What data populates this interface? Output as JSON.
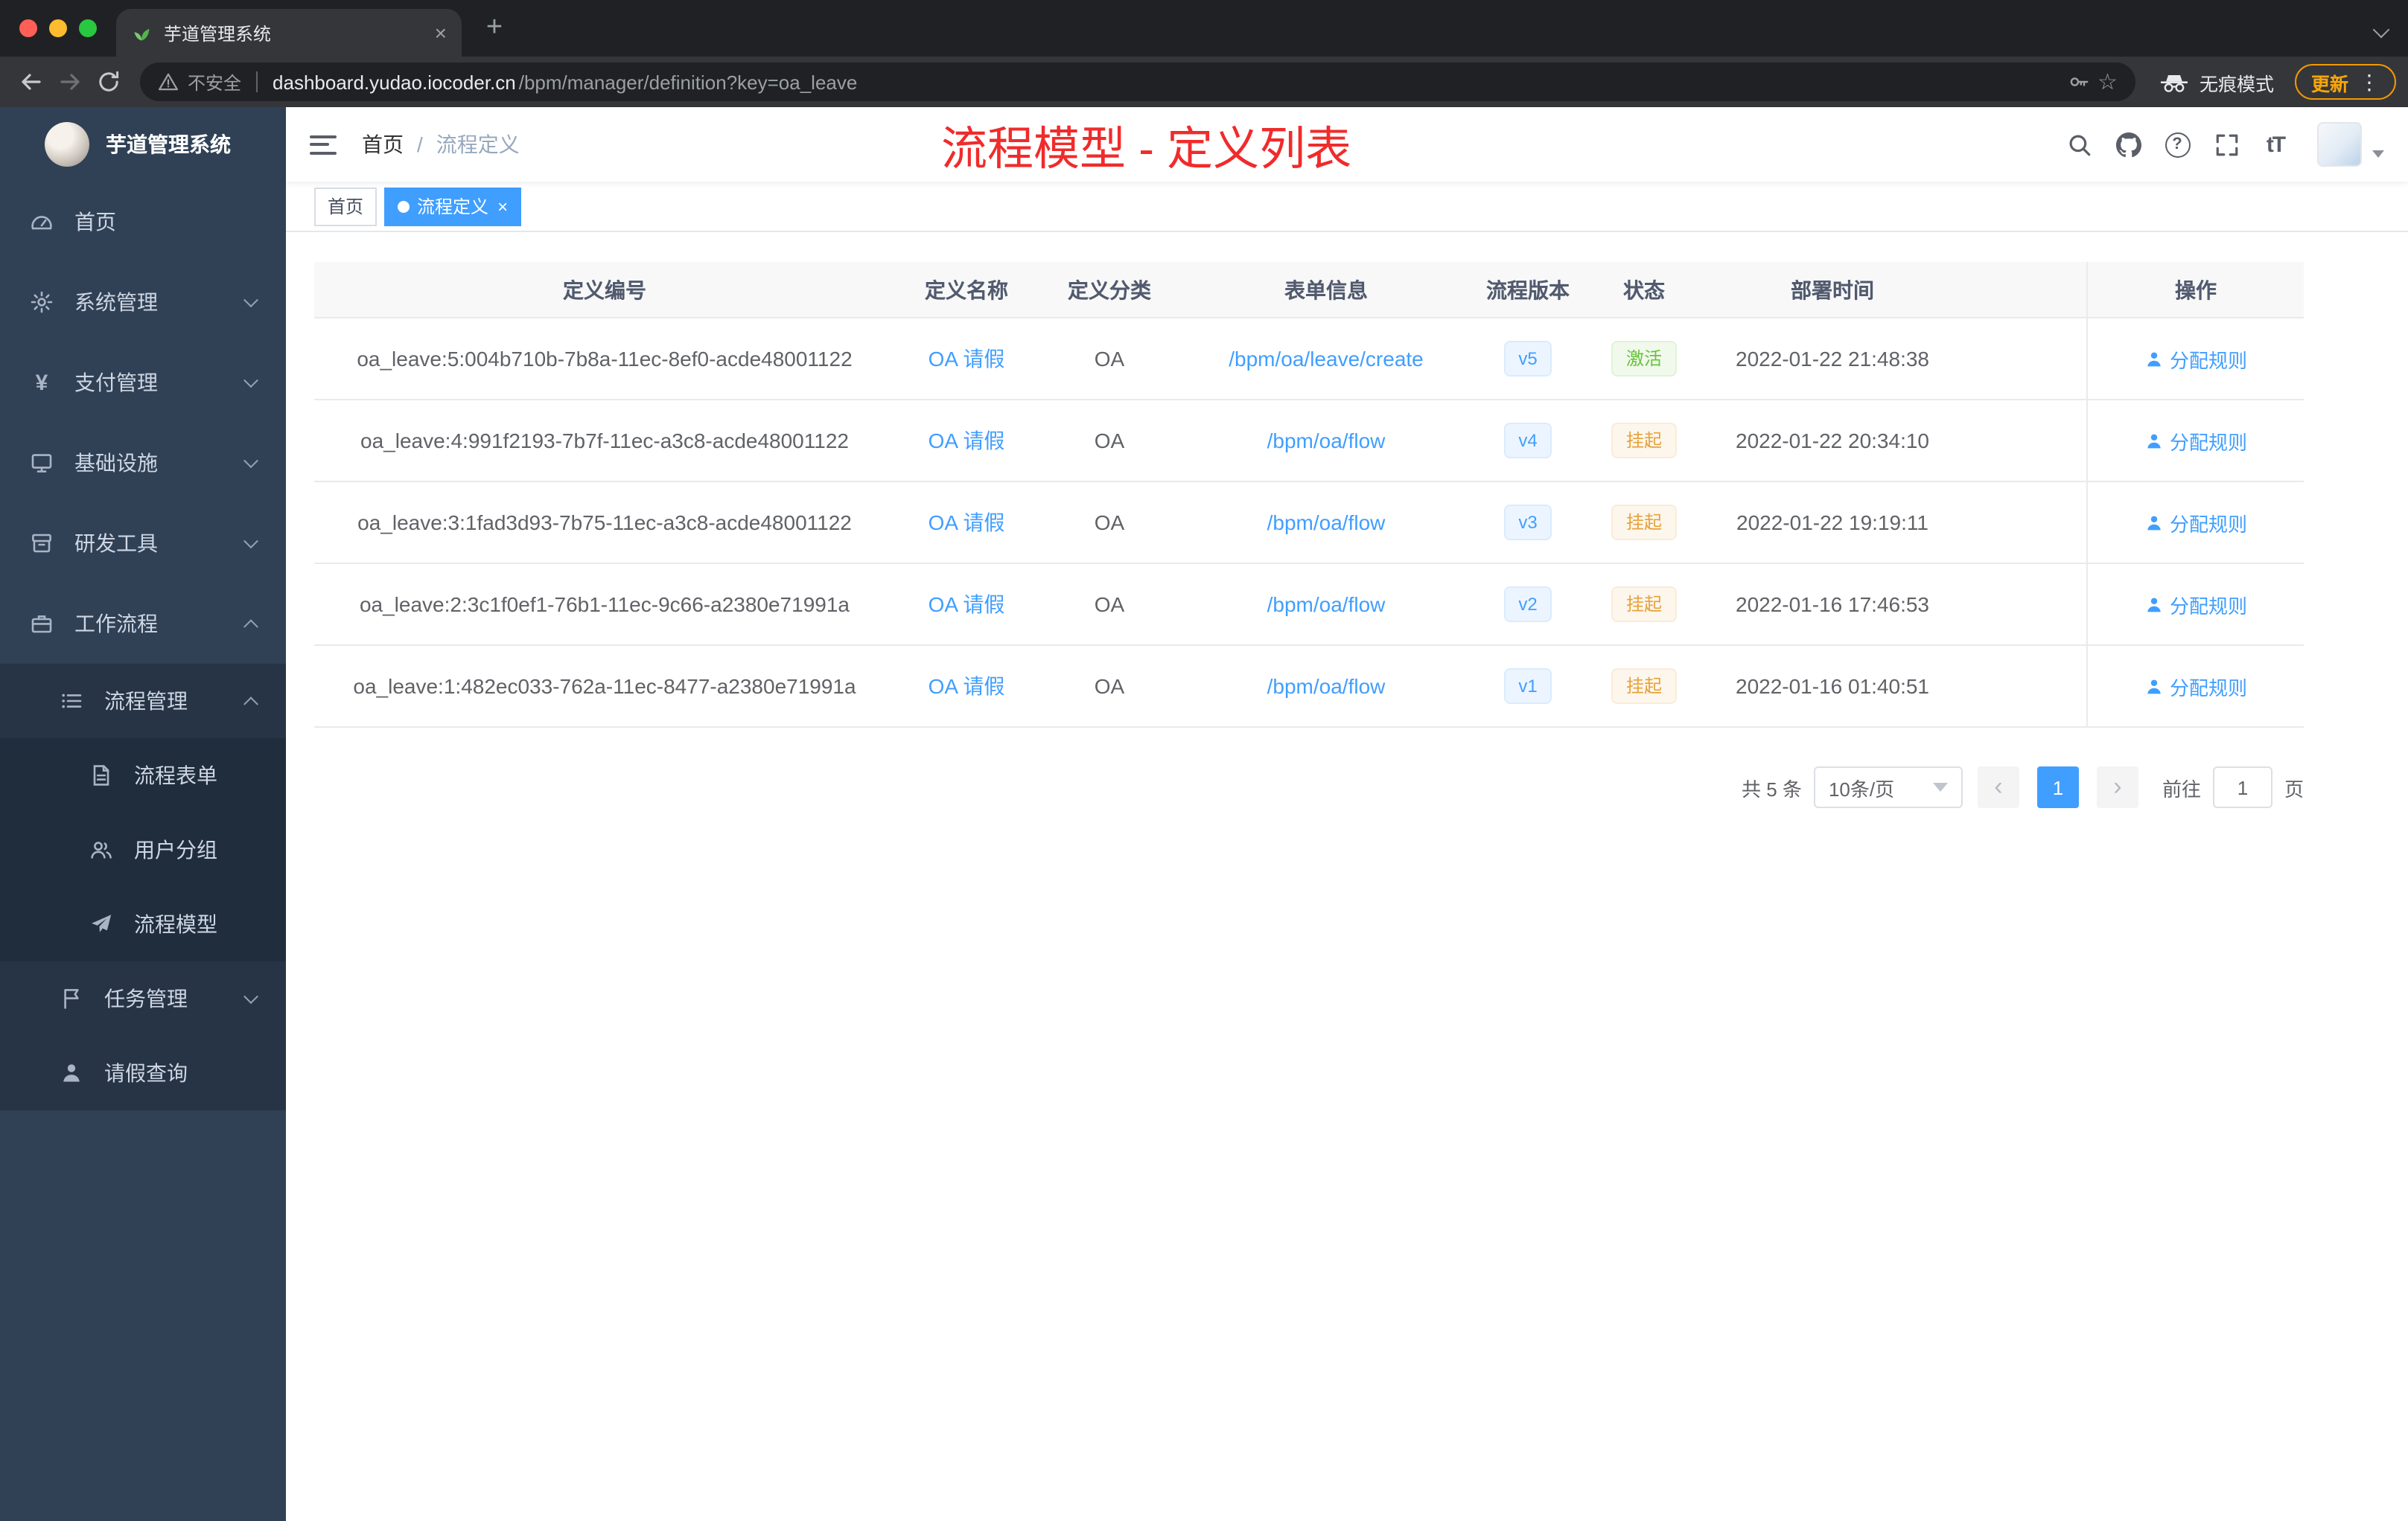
{
  "browser": {
    "tab_title": "芋道管理系统",
    "security_label": "不安全",
    "url_host": "dashboard.yudao.iocoder.cn",
    "url_path": "/bpm/manager/definition?key=oa_leave",
    "incognito_label": "无痕模式",
    "update_label": "更新"
  },
  "sidebar": {
    "logo_title": "芋道管理系统",
    "items": [
      {
        "label": "首页"
      },
      {
        "label": "系统管理"
      },
      {
        "label": "支付管理"
      },
      {
        "label": "基础设施"
      },
      {
        "label": "研发工具"
      },
      {
        "label": "工作流程"
      }
    ],
    "submenu": {
      "process_group": "流程管理",
      "children": [
        {
          "label": "流程表单"
        },
        {
          "label": "用户分组"
        },
        {
          "label": "流程模型"
        }
      ],
      "task_group": "任务管理",
      "leave_item": "请假查询"
    }
  },
  "header": {
    "breadcrumb_home": "首页",
    "breadcrumb_sep": "/",
    "breadcrumb_current": "流程定义",
    "annotation": "流程模型 - 定义列表",
    "font_icon_label": "tT",
    "question_glyph": "?"
  },
  "tags": {
    "home": "首页",
    "active": "流程定义"
  },
  "table": {
    "columns": [
      "定义编号",
      "定义名称",
      "定义分类",
      "表单信息",
      "流程版本",
      "状态",
      "部署时间",
      "操作"
    ],
    "rows": [
      {
        "id": "oa_leave:5:004b710b-7b8a-11ec-8ef0-acde48001122",
        "name": "OA 请假",
        "category": "OA",
        "form": "/bpm/oa/leave/create",
        "version": "v5",
        "status": "激活",
        "status_type": "success",
        "deployed": "2022-01-22 21:48:38",
        "action": "分配规则"
      },
      {
        "id": "oa_leave:4:991f2193-7b7f-11ec-a3c8-acde48001122",
        "name": "OA 请假",
        "category": "OA",
        "form": "/bpm/oa/flow",
        "version": "v4",
        "status": "挂起",
        "status_type": "warning",
        "deployed": "2022-01-22 20:34:10",
        "action": "分配规则"
      },
      {
        "id": "oa_leave:3:1fad3d93-7b75-11ec-a3c8-acde48001122",
        "name": "OA 请假",
        "category": "OA",
        "form": "/bpm/oa/flow",
        "version": "v3",
        "status": "挂起",
        "status_type": "warning",
        "deployed": "2022-01-22 19:19:11",
        "action": "分配规则"
      },
      {
        "id": "oa_leave:2:3c1f0ef1-76b1-11ec-9c66-a2380e71991a",
        "name": "OA 请假",
        "category": "OA",
        "form": "/bpm/oa/flow",
        "version": "v2",
        "status": "挂起",
        "status_type": "warning",
        "deployed": "2022-01-16 17:46:53",
        "action": "分配规则"
      },
      {
        "id": "oa_leave:1:482ec033-762a-11ec-8477-a2380e71991a",
        "name": "OA 请假",
        "category": "OA",
        "form": "/bpm/oa/flow",
        "version": "v1",
        "status": "挂起",
        "status_type": "warning",
        "deployed": "2022-01-16 01:40:51",
        "action": "分配规则"
      }
    ]
  },
  "pagination": {
    "total": "共 5 条",
    "page_size": "10条/页",
    "page": "1",
    "goto_label": "前往",
    "goto_value": "1",
    "page_unit": "页"
  },
  "icons": {
    "close": "×",
    "plus": "+",
    "kebab": "⋮",
    "star": "☆",
    "prev": "‹",
    "next": "›",
    "yen": "¥"
  },
  "colors": {
    "accent": "#409eff",
    "success_text": "#67c23a",
    "warning_text": "#e6a23c",
    "annotation": "#f02b2b",
    "sidebar_bg": "#304156"
  }
}
